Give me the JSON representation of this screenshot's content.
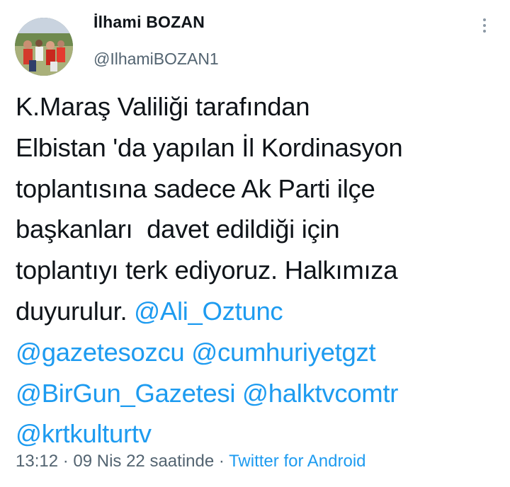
{
  "author": {
    "name": "İlhami BOZAN",
    "handle": "@IlhamiBOZAN1"
  },
  "icons": {
    "more": "more-vertical-icon",
    "avatar": "profile-avatar"
  },
  "tweet": {
    "line1": "K.Maraş Valiliği tarafından",
    "line2": "Elbistan 'da yapılan İl Kordinasyon",
    "line3": "toplantısına sadece Ak Parti ilçe",
    "line4": "başkanları  davet edildiği için",
    "line5": "toplantıyı terk ediyoruz. Halkımıza",
    "line6_text": "duyurulur. ",
    "mentions": [
      "@Ali_Oztunc",
      "@gazetesozcu",
      "@cumhuriyetgzt",
      "@BirGun_Gazetesi",
      "@halktvcomtr",
      "@krtkulturtv"
    ]
  },
  "meta": {
    "time": "13:12",
    "separator": " · ",
    "date": "09 Nis 22 saatinde",
    "source": "Twitter for Android"
  },
  "colors": {
    "text": "#0f1419",
    "secondary": "#536471",
    "link": "#1d9bf0",
    "background": "#ffffff"
  }
}
